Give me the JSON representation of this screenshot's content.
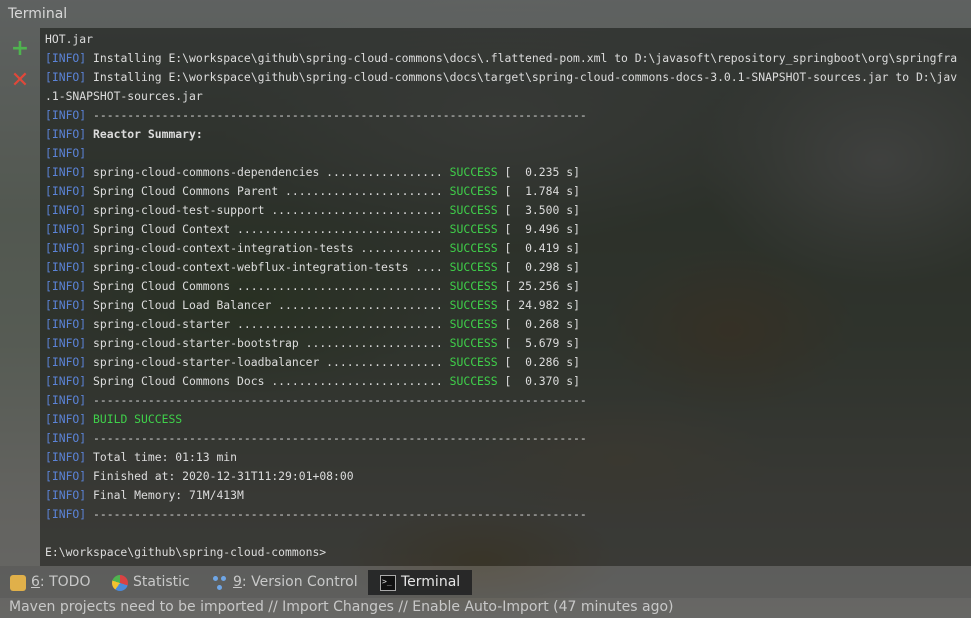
{
  "window": {
    "title": "Terminal"
  },
  "leftbar": {
    "add_icon": "plus-icon",
    "close_icon": "close-icon"
  },
  "terminal": {
    "lines": [
      {
        "prefix": "",
        "text": "HOT.jar"
      },
      {
        "prefix": "[INFO]",
        "text": " Installing E:\\workspace\\github\\spring-cloud-commons\\docs\\.flattened-pom.xml to D:\\javasoft\\repository_springboot\\org\\springfra"
      },
      {
        "prefix": "[INFO]",
        "text": " Installing E:\\workspace\\github\\spring-cloud-commons\\docs\\target\\spring-cloud-commons-docs-3.0.1-SNAPSHOT-sources.jar to D:\\jav"
      },
      {
        "prefix": "",
        "text": ".1-SNAPSHOT-sources.jar"
      },
      {
        "prefix": "[INFO]",
        "text": " ------------------------------------------------------------------------"
      },
      {
        "prefix": "[INFO]",
        "text": " Reactor Summary:",
        "bold": true
      },
      {
        "prefix": "[INFO]",
        "text": ""
      },
      {
        "prefix": "[INFO]",
        "text": " spring-cloud-commons-dependencies ................. ",
        "status": "SUCCESS",
        "time": " [  0.235 s]"
      },
      {
        "prefix": "[INFO]",
        "text": " Spring Cloud Commons Parent ....................... ",
        "status": "SUCCESS",
        "time": " [  1.784 s]"
      },
      {
        "prefix": "[INFO]",
        "text": " spring-cloud-test-support ......................... ",
        "status": "SUCCESS",
        "time": " [  3.500 s]"
      },
      {
        "prefix": "[INFO]",
        "text": " Spring Cloud Context .............................. ",
        "status": "SUCCESS",
        "time": " [  9.496 s]"
      },
      {
        "prefix": "[INFO]",
        "text": " spring-cloud-context-integration-tests ............ ",
        "status": "SUCCESS",
        "time": " [  0.419 s]"
      },
      {
        "prefix": "[INFO]",
        "text": " spring-cloud-context-webflux-integration-tests .... ",
        "status": "SUCCESS",
        "time": " [  0.298 s]"
      },
      {
        "prefix": "[INFO]",
        "text": " Spring Cloud Commons .............................. ",
        "status": "SUCCESS",
        "time": " [ 25.256 s]"
      },
      {
        "prefix": "[INFO]",
        "text": " Spring Cloud Load Balancer ........................ ",
        "status": "SUCCESS",
        "time": " [ 24.982 s]"
      },
      {
        "prefix": "[INFO]",
        "text": " spring-cloud-starter .............................. ",
        "status": "SUCCESS",
        "time": " [  0.268 s]"
      },
      {
        "prefix": "[INFO]",
        "text": " spring-cloud-starter-bootstrap .................... ",
        "status": "SUCCESS",
        "time": " [  5.679 s]"
      },
      {
        "prefix": "[INFO]",
        "text": " spring-cloud-starter-loadbalancer ................. ",
        "status": "SUCCESS",
        "time": " [  0.286 s]"
      },
      {
        "prefix": "[INFO]",
        "text": " Spring Cloud Commons Docs ......................... ",
        "status": "SUCCESS",
        "time": " [  0.370 s]"
      },
      {
        "prefix": "[INFO]",
        "text": " ------------------------------------------------------------------------"
      },
      {
        "prefix": "[INFO]",
        "text": " ",
        "status": "BUILD SUCCESS"
      },
      {
        "prefix": "[INFO]",
        "text": " ------------------------------------------------------------------------"
      },
      {
        "prefix": "[INFO]",
        "text": " Total time: 01:13 min"
      },
      {
        "prefix": "[INFO]",
        "text": " Finished at: 2020-12-31T11:29:01+08:00"
      },
      {
        "prefix": "[INFO]",
        "text": " Final Memory: 71M/413M"
      },
      {
        "prefix": "[INFO]",
        "text": " ------------------------------------------------------------------------"
      },
      {
        "prefix": "",
        "text": ""
      },
      {
        "prefix": "",
        "text": "E:\\workspace\\github\\spring-cloud-commons>"
      }
    ]
  },
  "tabs": [
    {
      "key": "6",
      "label": ": TODO",
      "icon": "todo-icon"
    },
    {
      "key": "",
      "label": "Statistic",
      "icon": "statistic-icon"
    },
    {
      "key": "9",
      "label": ": Version Control",
      "icon": "version-control-icon"
    },
    {
      "key": "",
      "label": "Terminal",
      "icon": "terminal-icon",
      "active": true
    }
  ],
  "status": {
    "message": "Maven projects need to be imported // Import Changes // Enable Auto-Import (47 minutes ago)"
  }
}
